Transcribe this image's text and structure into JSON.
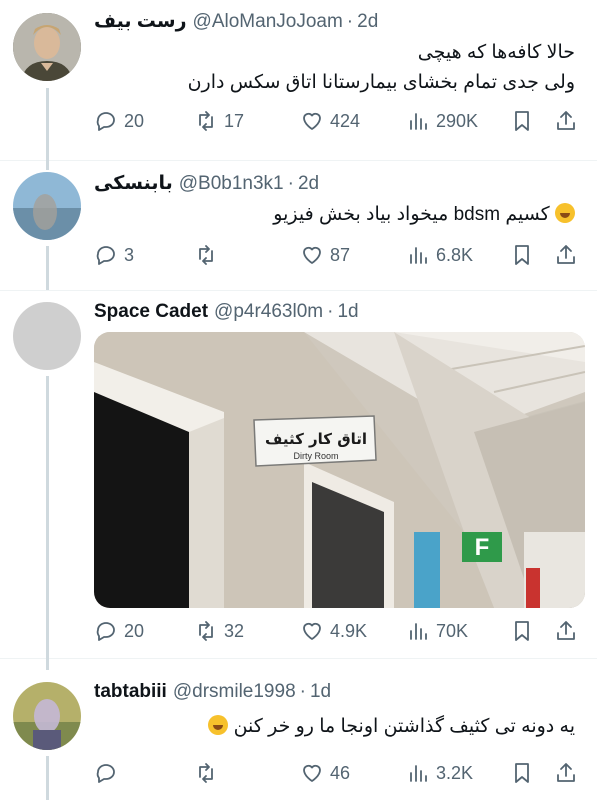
{
  "tweets": [
    {
      "name": "رست بیف",
      "handle": "@AloManJoJoam",
      "time": "2d",
      "lines": [
        "حالا کافه‌ها که هیچی",
        "ولی جدی تمام بخشای بیمارستانا اتاق سکس دارن"
      ],
      "reply_count": "20",
      "retweet_count": "17",
      "like_count": "424",
      "view_count": "290K"
    },
    {
      "name": "بابنسکی",
      "handle": "@B0b1n3k1",
      "time": "2d",
      "lines": [
        "کسیم bdsm میخواد بیاد بخش فیزیو"
      ],
      "reply_count": "3",
      "retweet_count": "",
      "like_count": "87",
      "view_count": "6.8K"
    },
    {
      "name": "Space Cadet",
      "handle": "@p4r463l0m",
      "time": "1d",
      "lines": [],
      "media": {
        "sign_fa": "اتاق کار کثیف",
        "sign_en": "Dirty Room",
        "exit_letter": "F"
      },
      "reply_count": "20",
      "retweet_count": "32",
      "like_count": "4.9K",
      "view_count": "70K"
    },
    {
      "name": "tabtabiii",
      "handle": "@drsmile1998",
      "time": "1d",
      "lines": [
        "یه دونه تی کثیف گذاشتن اونجا ما رو خر کنن"
      ],
      "reply_count": "",
      "retweet_count": "",
      "like_count": "46",
      "view_count": "3.2K"
    }
  ],
  "separator": "·",
  "icons": [
    "reply-icon",
    "retweet-icon",
    "like-icon",
    "views-icon",
    "bookmark-icon",
    "share-icon"
  ],
  "colors": {
    "text": "#0f1419",
    "secondary": "#536471",
    "line": "#cfd9de"
  }
}
